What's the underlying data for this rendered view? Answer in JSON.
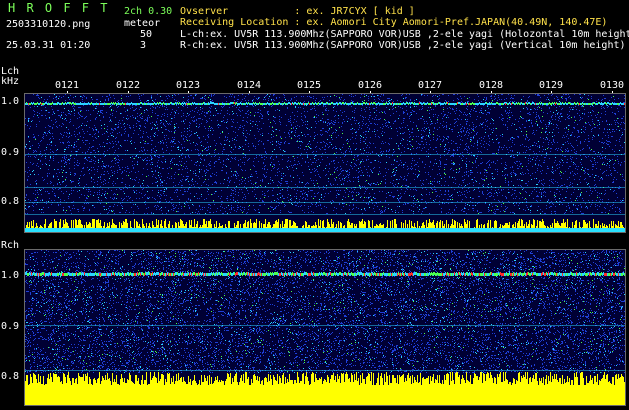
{
  "header": {
    "logo_text": "H R O F F T",
    "filename": "2503310120.png",
    "datetime": "25.03.31 01:20",
    "mode": "2ch 0.30",
    "meteor_label": "meteor",
    "lch_count": "50",
    "rch_count": "3",
    "observer_line": "Ovserver           : ex. JR7CYX [ kid ]",
    "location_line": "Receiving Location : ex. Aomori City Aomori-Pref.JAPAN(40.49N, 140.47E)",
    "lch_line": "L-ch:ex. UV5R 113.900Mhz(SAPPORO VOR)USB ,2-ele yagi (Holozontal 10m height)",
    "rch_line": "R-ch:ex. UV5R 113.900Mhz(SAPPORO VOR)USB ,2-ele yagi (Vertical 10m height)"
  },
  "axis": {
    "lch_label": "Lch",
    "khz_label": "kHz",
    "rch_label": "Rch",
    "time_ticks": [
      "0121",
      "0122",
      "0123",
      "0124",
      "0125",
      "0126",
      "0127",
      "0128",
      "0129",
      "0130"
    ],
    "lch_y_ticks": [
      "1.0",
      "0.9",
      "0.8"
    ],
    "rch_y_ticks": [
      "1.0",
      "0.9",
      "0.8"
    ]
  },
  "colors": {
    "background": "#000034",
    "noise_blue": "#1f3fd6",
    "noise_cyan": "#2ad3ff",
    "signal_green": "#4dff4d",
    "signal_red": "#ff2a2a",
    "bars": "#ffff00",
    "cyan_band": "#29e1ff"
  }
}
